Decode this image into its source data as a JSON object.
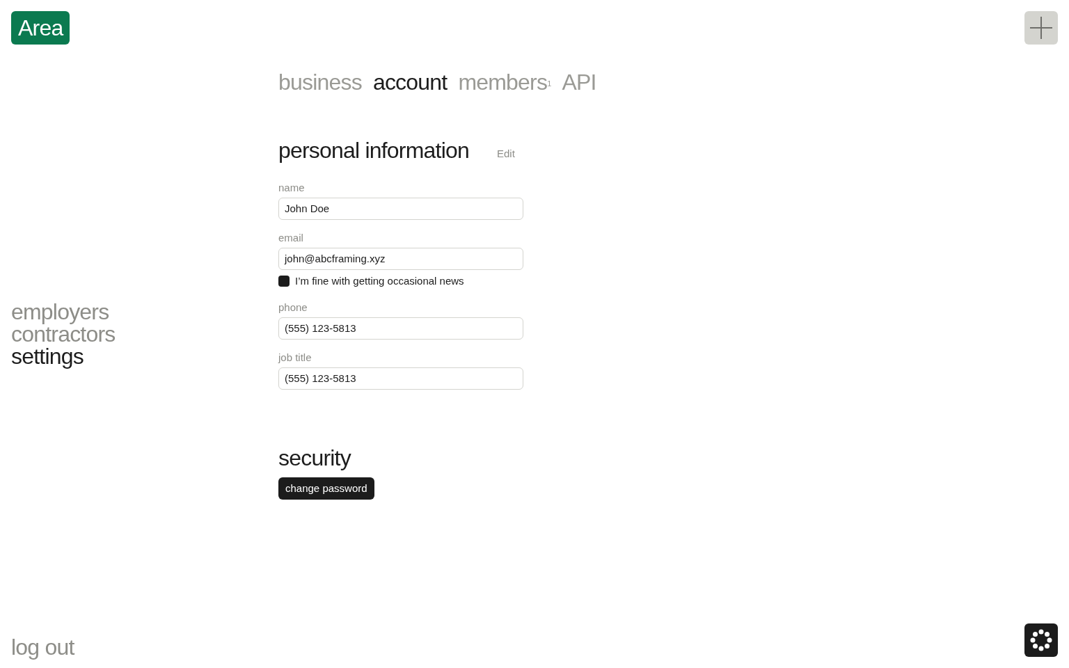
{
  "logo": "Area",
  "tabs": [
    {
      "label": "business",
      "selected": false
    },
    {
      "label": "account",
      "selected": true
    },
    {
      "label": "members$^{1}$",
      "selected": false
    },
    {
      "label": "API",
      "selected": false
    }
  ],
  "sidebar": {
    "items": [
      {
        "label": "employers",
        "selected": false
      },
      {
        "label": "contractors",
        "selected": false
      },
      {
        "label": "settings",
        "selected": true
      }
    ],
    "logout": "log out"
  },
  "personal_information": {
    "title": "personal information",
    "edit": "Edit",
    "fields": [
      {
        "kind": "field",
        "label": "name",
        "value": "John Doe"
      },
      {
        "kind": "field",
        "label": "email",
        "value": "john@abcframing.xyz"
      },
      {
        "kind": "checkbox",
        "label": "I’m fine with getting occasional news",
        "checked": true
      },
      {
        "kind": "field",
        "label": "phone",
        "value": "(555) 123-5813"
      },
      {
        "kind": "field",
        "label": "job title",
        "value": "(555) 123-5813"
      }
    ]
  },
  "security": {
    "title": "security",
    "button": "change password"
  }
}
